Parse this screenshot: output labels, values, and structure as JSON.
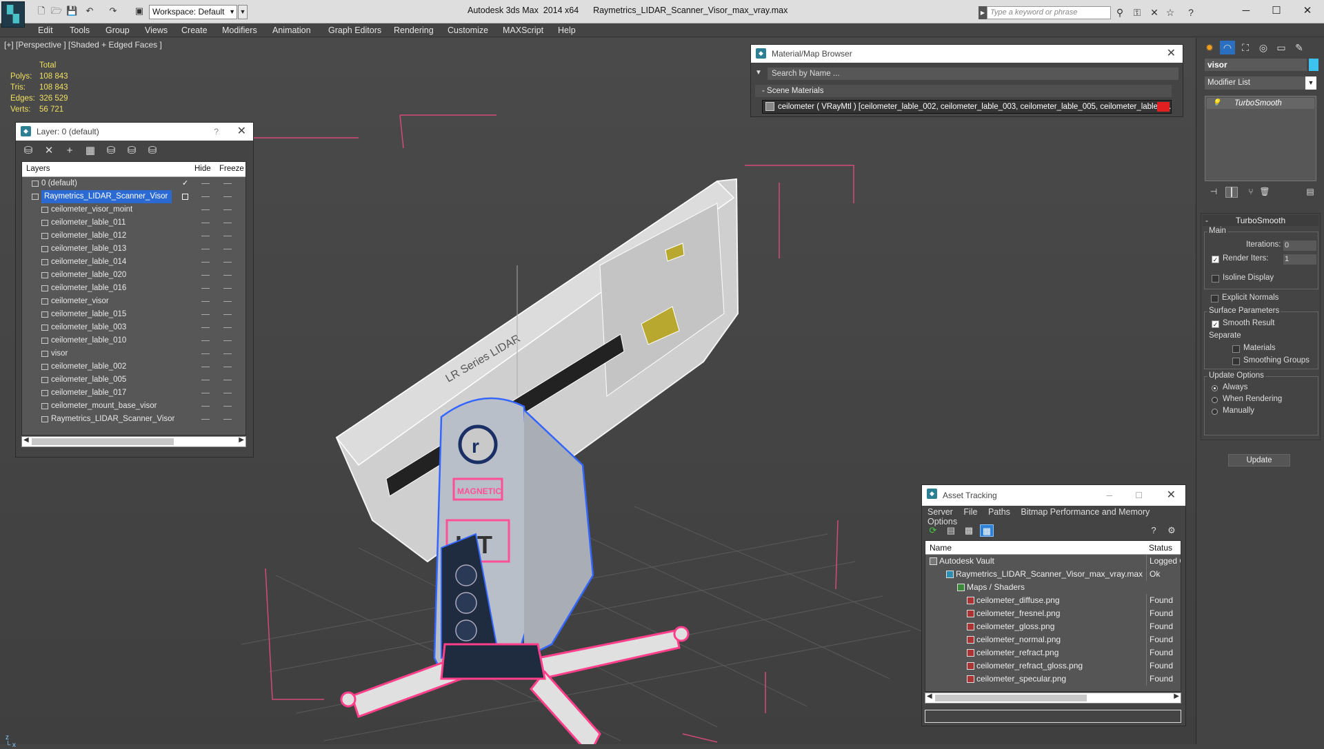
{
  "titlebar": {
    "workspace": "Workspace: Default",
    "app": "Autodesk 3ds Max  2014 x64",
    "file": "Raymetrics_LIDAR_Scanner_Visor_max_vray.max",
    "search_placeholder": "Type a keyword or phrase"
  },
  "menu": [
    "Edit",
    "Tools",
    "Group",
    "Views",
    "Create",
    "Modifiers",
    "Animation",
    "Graph Editors",
    "Rendering",
    "Customize",
    "MAXScript",
    "Help"
  ],
  "viewport": {
    "label": "[+] [Perspective ] [Shaded + Edged Faces ]",
    "stats": {
      "header": "Total",
      "rows": [
        {
          "label": "Polys:",
          "value": "108 843"
        },
        {
          "label": "Tris:",
          "value": "108 843"
        },
        {
          "label": "Edges:",
          "value": "326 529"
        },
        {
          "label": "Verts:",
          "value": "56 721"
        }
      ]
    },
    "model_texts": [
      "LR Series  LIDAR",
      "MAGNETIC",
      "LIT"
    ]
  },
  "layer_panel": {
    "title": "Layer: 0 (default)",
    "help": "?",
    "columns": {
      "layers": "Layers",
      "hide": "Hide",
      "freeze": "Freeze"
    },
    "rows": [
      {
        "name": "0 (default)",
        "level": 0
      },
      {
        "name": "Raymetrics_LIDAR_Scanner_Visor",
        "level": 0
      },
      {
        "name": "ceilometer_visor_moint",
        "level": 1
      },
      {
        "name": "ceilometer_lable_011",
        "level": 1
      },
      {
        "name": "ceilometer_lable_012",
        "level": 1
      },
      {
        "name": "ceilometer_lable_013",
        "level": 1
      },
      {
        "name": "ceilometer_lable_014",
        "level": 1
      },
      {
        "name": "ceilometer_lable_020",
        "level": 1
      },
      {
        "name": "ceilometer_lable_016",
        "level": 1
      },
      {
        "name": "ceilometer_visor",
        "level": 1
      },
      {
        "name": "ceilometer_lable_015",
        "level": 1
      },
      {
        "name": "ceilometer_lable_003",
        "level": 1
      },
      {
        "name": "ceilometer_lable_010",
        "level": 1
      },
      {
        "name": "visor",
        "level": 1
      },
      {
        "name": "ceilometer_lable_002",
        "level": 1
      },
      {
        "name": "ceilometer_lable_005",
        "level": 1
      },
      {
        "name": "ceilometer_lable_017",
        "level": 1
      },
      {
        "name": "ceilometer_mount_base_visor",
        "level": 1
      },
      {
        "name": "Raymetrics_LIDAR_Scanner_Visor",
        "level": 1
      }
    ]
  },
  "material_browser": {
    "title": "Material/Map Browser",
    "search_placeholder": "Search by Name ...",
    "section": "- Scene Materials",
    "material": "ceilometer  ( VRayMtl ) [ceilometer_lable_002, ceilometer_lable_003, ceilometer_lable_005, ceilometer_lable_0..."
  },
  "command_panel": {
    "object_name": "visor",
    "object_color": "#3cc3f0",
    "modifier_list": "Modifier List",
    "stack_item": "TurboSmooth",
    "rollout_title": "TurboSmooth",
    "main_group": "Main",
    "iterations_label": "Iterations:",
    "iterations_value": "0",
    "render_iters_label": "Render Iters:",
    "render_iters_value": "1",
    "render_iters_checked": true,
    "isoline_label": "Isoline Display",
    "explicit_label": "Explicit Normals",
    "surface_group": "Surface Parameters",
    "smooth_label": "Smooth Result",
    "separate_label": "Separate",
    "materials_label": "Materials",
    "smoothing_label": "Smoothing Groups",
    "update_group": "Update Options",
    "update_options": [
      "Always",
      "When Rendering",
      "Manually"
    ],
    "update_selected": "Always",
    "update_button": "Update"
  },
  "asset_tracking": {
    "title": "Asset Tracking",
    "menu": [
      "Server",
      "File",
      "Paths",
      "Bitmap Performance and Memory",
      "Options"
    ],
    "columns": {
      "name": "Name",
      "status": "Status"
    },
    "rows": [
      {
        "name": "Autodesk Vault",
        "status": "Logged O",
        "indent": 20
      },
      {
        "name": "Raymetrics_LIDAR_Scanner_Visor_max_vray.max",
        "status": "Ok",
        "indent": 44
      },
      {
        "name": "Maps / Shaders",
        "status": "",
        "indent": 60
      },
      {
        "name": "ceilometer_diffuse.png",
        "status": "Found",
        "indent": 74
      },
      {
        "name": "ceilometer_fresnel.png",
        "status": "Found",
        "indent": 74
      },
      {
        "name": "ceilometer_gloss.png",
        "status": "Found",
        "indent": 74
      },
      {
        "name": "ceilometer_normal.png",
        "status": "Found",
        "indent": 74
      },
      {
        "name": "ceilometer_refract.png",
        "status": "Found",
        "indent": 74
      },
      {
        "name": "ceilometer_refract_gloss.png",
        "status": "Found",
        "indent": 74
      },
      {
        "name": "ceilometer_specular.png",
        "status": "Found",
        "indent": 74
      }
    ]
  }
}
